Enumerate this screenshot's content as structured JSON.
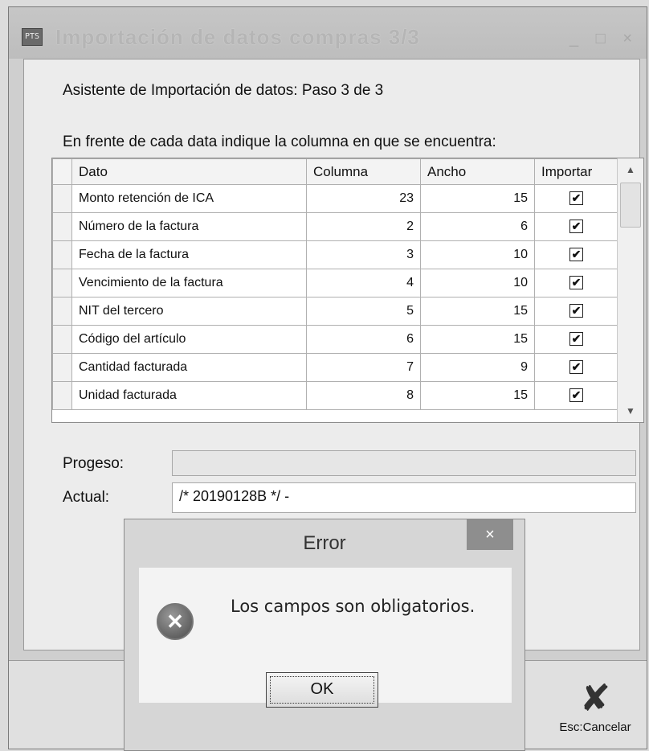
{
  "window": {
    "title": "Importación de datos compras 3/3",
    "controls": "_ □ ×",
    "icon": "app-icon"
  },
  "wizard": {
    "step_text": "Asistente de Importación de datos: Paso 3 de 3",
    "instruction": "En frente de cada data indique la columna en que se encuentra:"
  },
  "grid": {
    "columns": [
      "Dato",
      "Columna",
      "Ancho",
      "Importar"
    ],
    "rows": [
      {
        "dato": "Monto retención de ICA",
        "columna": "23",
        "ancho": "15",
        "importar": "✔"
      },
      {
        "dato": "Número de la factura",
        "columna": "2",
        "ancho": "6",
        "importar": "✔"
      },
      {
        "dato": "Fecha de la factura",
        "columna": "3",
        "ancho": "10",
        "importar": "✔"
      },
      {
        "dato": "Vencimiento de la factura",
        "columna": "4",
        "ancho": "10",
        "importar": "✔"
      },
      {
        "dato": "NIT del tercero",
        "columna": "5",
        "ancho": "15",
        "importar": "✔"
      },
      {
        "dato": "Código del artículo",
        "columna": "6",
        "ancho": "15",
        "importar": "✔"
      },
      {
        "dato": "Cantidad facturada",
        "columna": "7",
        "ancho": "9",
        "importar": "✔"
      },
      {
        "dato": "Unidad facturada",
        "columna": "8",
        "ancho": "15",
        "importar": "✔"
      }
    ]
  },
  "progress": {
    "label": "Progeso:",
    "value": 0
  },
  "current": {
    "label": "Actual:",
    "value": "/* 20190128B */ -"
  },
  "cancel": {
    "label": "Esc:Cancelar",
    "icon": "close-x-icon"
  },
  "dialog": {
    "title": "Error",
    "close": "×",
    "message": "Los campos  son obligatorios.",
    "icon": "error-icon",
    "ok_label": "OK"
  }
}
